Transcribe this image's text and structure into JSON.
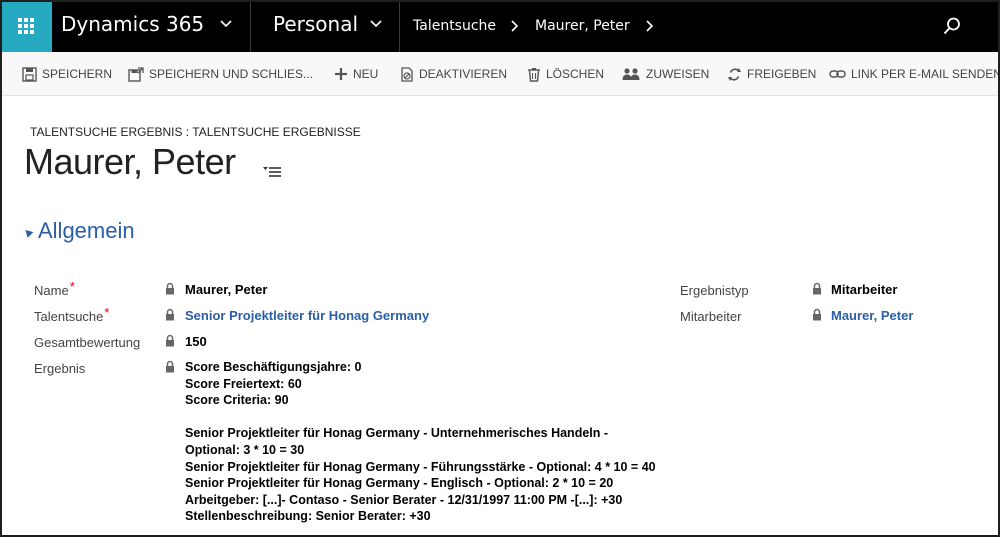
{
  "nav": {
    "brand": "Dynamics 365",
    "area": "Personal",
    "breadcrumb": [
      "Talentsuche",
      "Maurer, Peter"
    ],
    "icons": [
      "app-launcher-icon",
      "chevron-down-icon",
      "chevron-right-icon",
      "search-icon"
    ]
  },
  "toolbar": {
    "save": "SPEICHERN",
    "save_close": "SPEICHERN UND SCHLIES...",
    "new": "NEU",
    "deactivate": "DEAKTIVIEREN",
    "delete": "LÖSCHEN",
    "assign": "ZUWEISEN",
    "share": "FREIGEBEN",
    "email_link": "LINK PER E-MAIL SENDEN"
  },
  "record": {
    "entity": "TALENTSUCHE ERGEBNIS : TALENTSUCHE ERGEBNISSE",
    "title": "Maurer, Peter"
  },
  "section": {
    "title": "Allgemein"
  },
  "fields": {
    "name_label": "Name",
    "name_value": "Maurer, Peter",
    "talentsuche_label": "Talentsuche",
    "talentsuche_value": "Senior Projektleiter für Honag Germany",
    "gesamt_label": "Gesamtbewertung",
    "gesamt_value": "150",
    "ergebnis_label": "Ergebnis",
    "ergebnis_lines": [
      "Score Beschäftigungsjahre: 0",
      "Score Freiertext: 60",
      "Score Criteria: 90",
      "",
      "Senior Projektleiter für Honag Germany - Unternehmerisches Handeln -",
      "Optional: 3 * 10 = 30",
      "Senior Projektleiter für Honag Germany - Führungsstärke - Optional: 4 * 10 = 40",
      "Senior Projektleiter für Honag Germany - Englisch - Optional: 2 * 10 = 20",
      "Arbeitgeber: [...]- Contaso - Senior Berater - 12/31/1997 11:00 PM -[...]: +30",
      "Stellenbeschreibung: Senior Berater: +30"
    ],
    "ergebnistyp_label": "Ergebnistyp",
    "ergebnistyp_value": "Mitarbeiter",
    "mitarbeiter_label": "Mitarbeiter",
    "mitarbeiter_value": "Maurer, Peter"
  },
  "colors": {
    "nav_bg": "#000000",
    "launcher": "#25aac1",
    "link": "#2a5ea8",
    "required": "#d8000c"
  }
}
